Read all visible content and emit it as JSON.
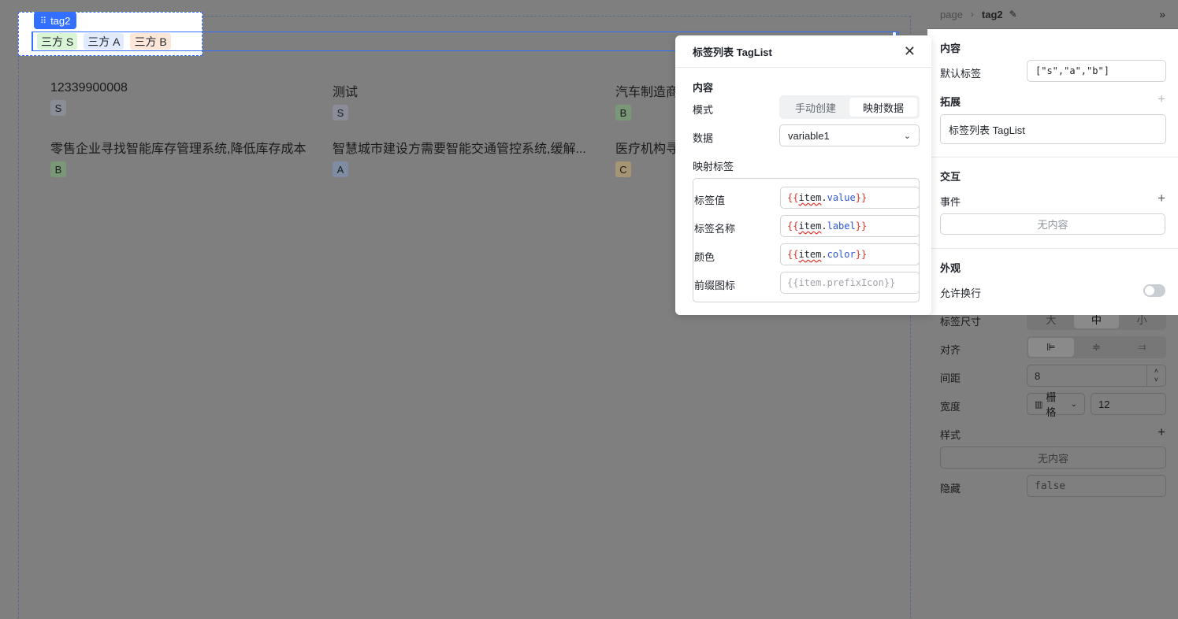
{
  "canvas": {
    "selected_component": "tag2",
    "tags": [
      {
        "label": "三方 S",
        "color": "green"
      },
      {
        "label": "三方 A",
        "color": "blue"
      },
      {
        "label": "三方 B",
        "color": "orange"
      }
    ],
    "cards": [
      {
        "title": "12339900008",
        "tag": "S"
      },
      {
        "title": "测试",
        "tag": "S"
      },
      {
        "title": "汽车制造商",
        "tag": "B"
      },
      {
        "title": "零售企业寻找智能库存管理系统,降低库存成本",
        "tag": "B"
      },
      {
        "title": "智慧城市建设方需要智能交通管控系统,缓解...",
        "tag": "A"
      },
      {
        "title": "医疗机构寻",
        "tag": "C"
      }
    ]
  },
  "panel": {
    "breadcrumb": {
      "root": "page",
      "current": "tag2"
    },
    "content_title": "内容",
    "default_tags_label": "默认标签",
    "default_tags_value": "[\"s\",\"a\",\"b\"]",
    "extend_title": "拓展",
    "extend_value": "标签列表 TagList",
    "interaction_title": "交互",
    "event_label": "事件",
    "event_empty": "无内容",
    "appearance_title": "外观",
    "wrap_label": "允许换行",
    "tag_size_label": "标签尺寸",
    "tag_size_options": [
      "大",
      "中",
      "小"
    ],
    "tag_size_selected": "中",
    "align_label": "对齐",
    "spacing_label": "间距",
    "spacing_value": "8",
    "width_label": "宽度",
    "width_mode": "栅格",
    "width_value": "12",
    "style_label": "样式",
    "style_empty": "无内容",
    "hidden_label": "隐藏",
    "hidden_value": "false"
  },
  "modal": {
    "title": "标签列表 TagList",
    "section": "内容",
    "mode_label": "模式",
    "mode_options": [
      "手动创建",
      "映射数据"
    ],
    "mode_selected": "映射数据",
    "data_label": "数据",
    "data_value": "variable1",
    "mapping_title": "映射标签",
    "mappings": [
      {
        "label": "标签值",
        "expr_prop": "value",
        "placeholder": false
      },
      {
        "label": "标签名称",
        "expr_prop": "label",
        "placeholder": false
      },
      {
        "label": "颜色",
        "expr_prop": "color",
        "placeholder": false
      },
      {
        "label": "前缀图标",
        "expr": "{{item.prefixIcon}}",
        "placeholder": true
      }
    ],
    "expr_open": "{{",
    "expr_item": "item",
    "expr_dot": ".",
    "expr_close": "}}"
  }
}
